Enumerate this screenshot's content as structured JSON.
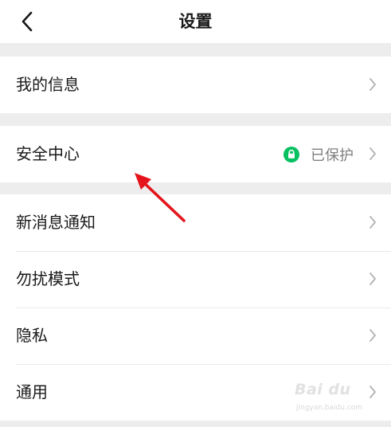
{
  "header": {
    "title": "设置",
    "back_icon": "chevron-left-icon"
  },
  "groups": [
    {
      "items": [
        {
          "label": "我的信息"
        }
      ]
    },
    {
      "items": [
        {
          "label": "安全中心",
          "status_text": "已保护",
          "status_icon": "lock-icon",
          "status_color": "#07c160"
        }
      ]
    },
    {
      "items": [
        {
          "label": "新消息通知"
        },
        {
          "label": "勿扰模式"
        },
        {
          "label": "隐私"
        },
        {
          "label": "通用"
        }
      ]
    }
  ],
  "annotation": {
    "arrow_color": "#e5141b"
  },
  "watermark": {
    "logo": "Bai du",
    "url": "jingyan.baidu.com"
  },
  "colors": {
    "background": "#ededed",
    "text": "#191919",
    "secondary_text": "#7f7f7f",
    "chevron": "#b2b2b2"
  }
}
